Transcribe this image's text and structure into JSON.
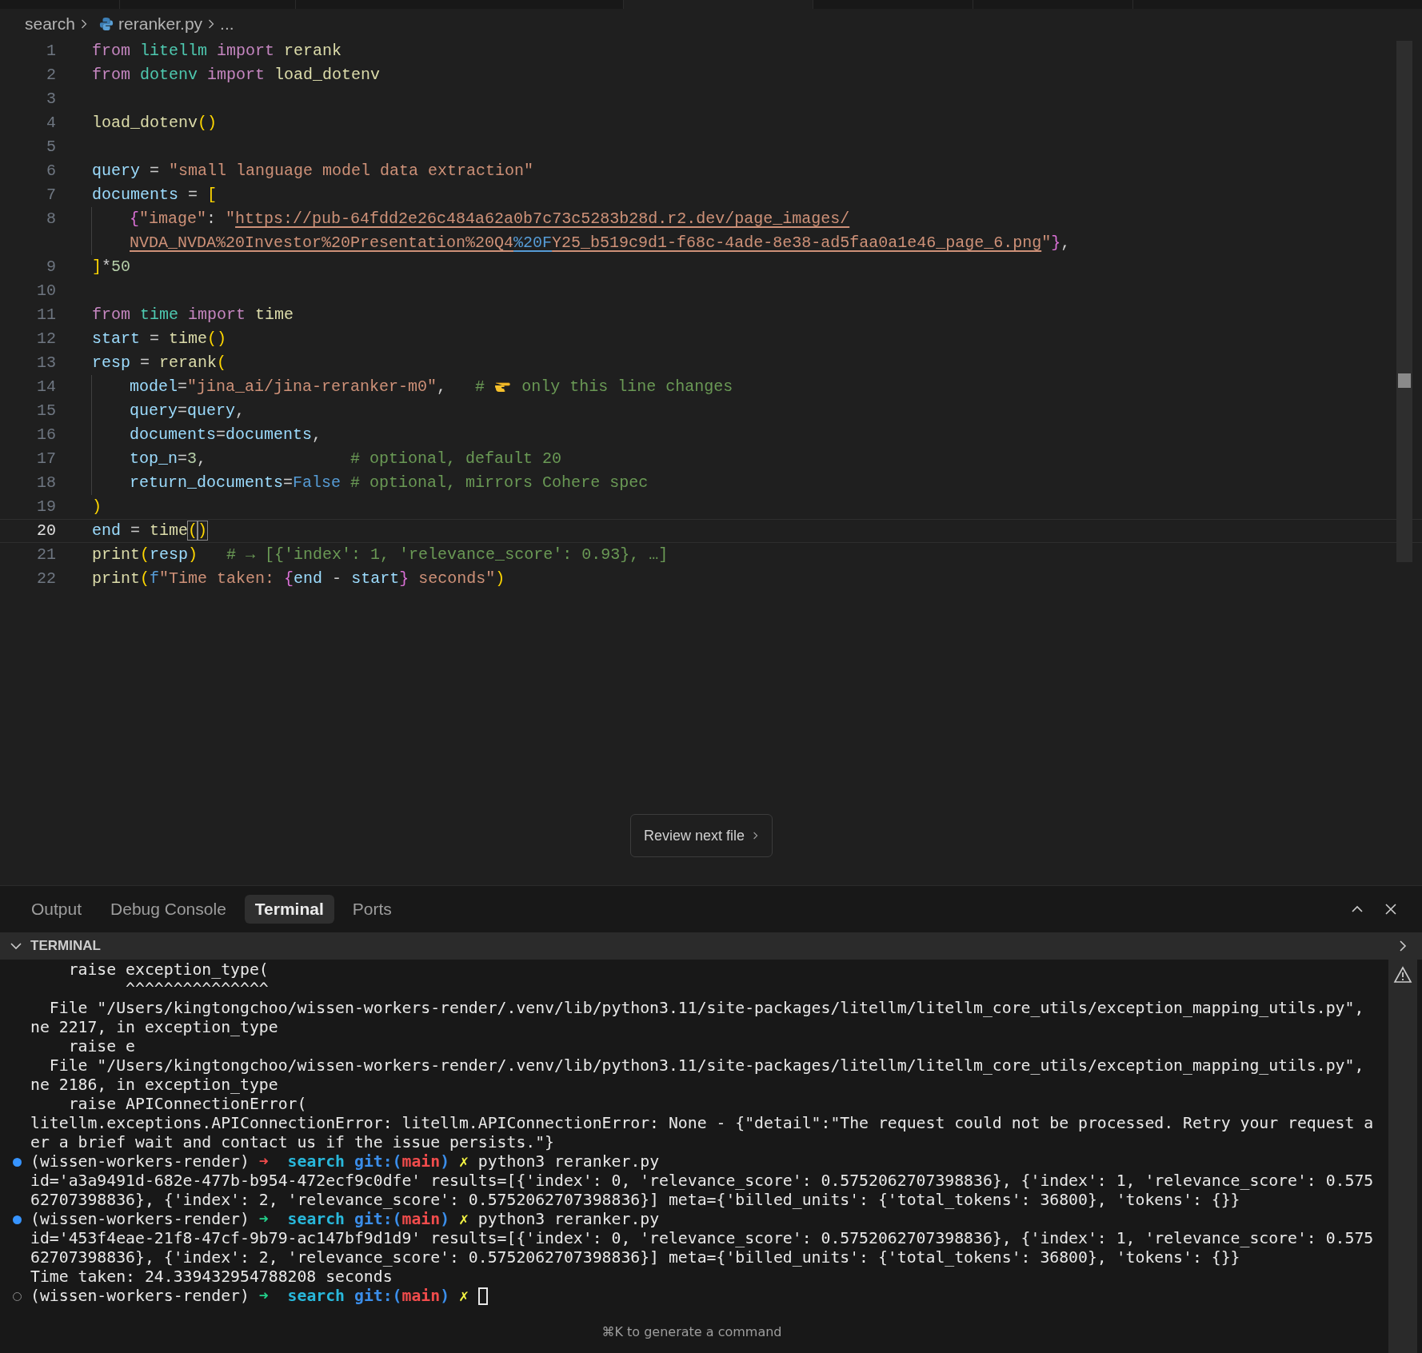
{
  "breadcrumb": {
    "folder": "search",
    "file": "reranker.py",
    "more": "..."
  },
  "editor": {
    "lines": [
      {
        "number": "1",
        "current": false,
        "indented": false,
        "rows": [
          [
            {
              "kind": "keyword",
              "text": "from "
            },
            {
              "kind": "module",
              "text": "litellm "
            },
            {
              "kind": "keyword",
              "text": "import "
            },
            {
              "kind": "function",
              "text": "rerank"
            }
          ]
        ]
      },
      {
        "number": "2",
        "current": false,
        "indented": false,
        "rows": [
          [
            {
              "kind": "keyword",
              "text": "from "
            },
            {
              "kind": "module",
              "text": "dotenv "
            },
            {
              "kind": "keyword",
              "text": "import "
            },
            {
              "kind": "function",
              "text": "load_dotenv"
            }
          ]
        ]
      },
      {
        "number": "3",
        "current": false,
        "indented": false,
        "rows": [
          []
        ]
      },
      {
        "number": "4",
        "current": false,
        "indented": false,
        "rows": [
          [
            {
              "kind": "function",
              "text": "load_dotenv"
            },
            {
              "kind": "bracket",
              "text": "()"
            }
          ]
        ]
      },
      {
        "number": "5",
        "current": false,
        "indented": false,
        "rows": [
          []
        ]
      },
      {
        "number": "6",
        "current": false,
        "indented": false,
        "rows": [
          [
            {
              "kind": "variable",
              "text": "query"
            },
            {
              "kind": "plain",
              "text": " = "
            },
            {
              "kind": "string",
              "text": "\"small language model data extraction\""
            }
          ]
        ]
      },
      {
        "number": "7",
        "current": false,
        "indented": false,
        "rows": [
          [
            {
              "kind": "variable",
              "text": "documents"
            },
            {
              "kind": "plain",
              "text": " = "
            },
            {
              "kind": "bracket",
              "text": "["
            }
          ]
        ]
      },
      {
        "number": "8",
        "current": false,
        "indented": true,
        "rows": [
          [
            {
              "kind": "brace",
              "text": "{"
            },
            {
              "kind": "string",
              "text": "\"image\""
            },
            {
              "kind": "plain",
              "text": ": "
            },
            {
              "kind": "string",
              "text": "\""
            },
            {
              "kind": "link",
              "text": "https://pub-64fdd2e26c484a62a0b7c73c5283b28d.r2.dev/page_images/"
            }
          ]
        ],
        "wrapped": [
          {
            "kind": "link",
            "text": "NVDA_NVDA%20Investor%20Presentation%20Q4"
          },
          {
            "kind": "link_escape",
            "text": "%20F"
          },
          {
            "kind": "link",
            "text": "Y25_b519c9d1-f68c-4ade-8e38-ad5faa0a1e46_page_6.png"
          },
          {
            "kind": "string",
            "text": "\""
          },
          {
            "kind": "brace",
            "text": "}"
          },
          {
            "kind": "plain",
            "text": ","
          }
        ]
      },
      {
        "number": "9",
        "current": false,
        "indented": false,
        "rows": [
          [
            {
              "kind": "bracket",
              "text": "]"
            },
            {
              "kind": "plain",
              "text": "*"
            },
            {
              "kind": "number",
              "text": "50"
            }
          ]
        ]
      },
      {
        "number": "10",
        "current": false,
        "indented": false,
        "rows": [
          []
        ]
      },
      {
        "number": "11",
        "current": false,
        "indented": false,
        "rows": [
          [
            {
              "kind": "keyword",
              "text": "from "
            },
            {
              "kind": "module",
              "text": "time "
            },
            {
              "kind": "keyword",
              "text": "import "
            },
            {
              "kind": "function",
              "text": "time"
            }
          ]
        ]
      },
      {
        "number": "12",
        "current": false,
        "indented": false,
        "rows": [
          [
            {
              "kind": "variable",
              "text": "start"
            },
            {
              "kind": "plain",
              "text": " = "
            },
            {
              "kind": "function",
              "text": "time"
            },
            {
              "kind": "bracket",
              "text": "()"
            }
          ]
        ]
      },
      {
        "number": "13",
        "current": false,
        "indented": false,
        "rows": [
          [
            {
              "kind": "variable",
              "text": "resp"
            },
            {
              "kind": "plain",
              "text": " = "
            },
            {
              "kind": "function",
              "text": "rerank"
            },
            {
              "kind": "bracket",
              "text": "("
            }
          ]
        ]
      },
      {
        "number": "14",
        "current": false,
        "indented": true,
        "rows": [
          [
            {
              "kind": "variable",
              "text": "model"
            },
            {
              "kind": "plain",
              "text": "="
            },
            {
              "kind": "string",
              "text": "\"jina_ai/jina-reranker-m0\""
            },
            {
              "kind": "plain",
              "text": ",   "
            },
            {
              "kind": "comment",
              "text": "# "
            },
            {
              "kind": "pointing_hand"
            },
            {
              "kind": "comment",
              "text": " only this line changes"
            }
          ]
        ]
      },
      {
        "number": "15",
        "current": false,
        "indented": true,
        "rows": [
          [
            {
              "kind": "variable",
              "text": "query"
            },
            {
              "kind": "plain",
              "text": "="
            },
            {
              "kind": "variable",
              "text": "query"
            },
            {
              "kind": "plain",
              "text": ","
            }
          ]
        ]
      },
      {
        "number": "16",
        "current": false,
        "indented": true,
        "rows": [
          [
            {
              "kind": "variable",
              "text": "documents"
            },
            {
              "kind": "plain",
              "text": "="
            },
            {
              "kind": "variable",
              "text": "documents"
            },
            {
              "kind": "plain",
              "text": ","
            }
          ]
        ]
      },
      {
        "number": "17",
        "current": false,
        "indented": true,
        "rows": [
          [
            {
              "kind": "variable",
              "text": "top_n"
            },
            {
              "kind": "plain",
              "text": "="
            },
            {
              "kind": "number",
              "text": "3"
            },
            {
              "kind": "plain",
              "text": ",               "
            },
            {
              "kind": "comment",
              "text": "# optional, default 20"
            }
          ]
        ]
      },
      {
        "number": "18",
        "current": false,
        "indented": true,
        "rows": [
          [
            {
              "kind": "variable",
              "text": "return_documents"
            },
            {
              "kind": "plain",
              "text": "="
            },
            {
              "kind": "constant",
              "text": "False"
            },
            {
              "kind": "plain",
              "text": " "
            },
            {
              "kind": "comment",
              "text": "# optional, mirrors Cohere spec"
            }
          ]
        ]
      },
      {
        "number": "19",
        "current": false,
        "indented": false,
        "rows": [
          [
            {
              "kind": "bracket",
              "text": ")"
            }
          ]
        ]
      },
      {
        "number": "20",
        "current": true,
        "indented": false,
        "rows": [
          [
            {
              "kind": "variable",
              "text": "end"
            },
            {
              "kind": "plain",
              "text": " = "
            },
            {
              "kind": "function",
              "text": "time"
            },
            {
              "kind": "bracket_match",
              "text": "("
            },
            {
              "kind": "bracket_match",
              "text": ")"
            }
          ]
        ]
      },
      {
        "number": "21",
        "current": false,
        "indented": false,
        "rows": [
          [
            {
              "kind": "function",
              "text": "print"
            },
            {
              "kind": "bracket",
              "text": "("
            },
            {
              "kind": "variable",
              "text": "resp"
            },
            {
              "kind": "bracket",
              "text": ")"
            },
            {
              "kind": "comment",
              "text": "   # → [{'index': 1, 'relevance_score': 0.93}, …]"
            }
          ]
        ]
      },
      {
        "number": "22",
        "current": false,
        "indented": false,
        "rows": [
          [
            {
              "kind": "function",
              "text": "print"
            },
            {
              "kind": "bracket",
              "text": "("
            },
            {
              "kind": "constant",
              "text": "f"
            },
            {
              "kind": "string",
              "text": "\"Time taken: "
            },
            {
              "kind": "brace",
              "text": "{"
            },
            {
              "kind": "variable",
              "text": "end"
            },
            {
              "kind": "plain",
              "text": " - "
            },
            {
              "kind": "variable",
              "text": "start"
            },
            {
              "kind": "brace",
              "text": "}"
            },
            {
              "kind": "string",
              "text": " seconds\""
            },
            {
              "kind": "bracket",
              "text": ")"
            }
          ]
        ]
      }
    ],
    "review_button": "Review next file"
  },
  "panel": {
    "tabs": [
      {
        "label": "Output",
        "selected": false
      },
      {
        "label": "Debug Console",
        "selected": false
      },
      {
        "label": "Terminal",
        "selected": true
      },
      {
        "label": "Ports",
        "selected": false
      }
    ],
    "section_title": "TERMINAL",
    "terminal_lines": [
      {
        "kind": "text",
        "text": "    raise exception_type("
      },
      {
        "kind": "text",
        "text": "          ^^^^^^^^^^^^^^^"
      },
      {
        "kind": "text",
        "text": "  File \"/Users/kingtongchoo/wissen-workers-render/.venv/lib/python3.11/site-packages/litellm/litellm_core_utils/exception_mapping_utils.py\","
      },
      {
        "kind": "text",
        "text": "ne 2217, in exception_type"
      },
      {
        "kind": "text",
        "text": "    raise e"
      },
      {
        "kind": "text",
        "text": "  File \"/Users/kingtongchoo/wissen-workers-render/.venv/lib/python3.11/site-packages/litellm/litellm_core_utils/exception_mapping_utils.py\","
      },
      {
        "kind": "text",
        "text": "ne 2186, in exception_type"
      },
      {
        "kind": "text",
        "text": "    raise APIConnectionError("
      },
      {
        "kind": "text",
        "text": "litellm.exceptions.APIConnectionError: litellm.APIConnectionError: None - {\"detail\":\"The request could not be processed. Retry your request a"
      },
      {
        "kind": "text",
        "text": "er a brief wait and contact us if the issue persists.\"}"
      },
      {
        "kind": "prompt",
        "ran": true,
        "last_ok": false,
        "env": "(wissen-workers-render) ",
        "arrow": "➜",
        "dir": "search",
        "git_open": "git:(",
        "branch": "main",
        "git_close": ")",
        "dirty": "✗",
        "command": "python3 reranker.py",
        "cursor": false
      },
      {
        "kind": "text",
        "text": "id='a3a9491d-682e-477b-b954-472ecf9c0dfe' results=[{'index': 0, 'relevance_score': 0.5752062707398836}, {'index': 1, 'relevance_score': 0.575"
      },
      {
        "kind": "text",
        "text": "62707398836}, {'index': 2, 'relevance_score': 0.5752062707398836}] meta={'billed_units': {'total_tokens': 36800}, 'tokens': {}}"
      },
      {
        "kind": "prompt",
        "ran": true,
        "last_ok": true,
        "env": "(wissen-workers-render) ",
        "arrow": "➜",
        "dir": "search",
        "git_open": "git:(",
        "branch": "main",
        "git_close": ")",
        "dirty": "✗",
        "command": "python3 reranker.py",
        "cursor": false
      },
      {
        "kind": "text",
        "text": "id='453f4eae-21f8-47cf-9b79-ac147bf9d1d9' results=[{'index': 0, 'relevance_score': 0.5752062707398836}, {'index': 1, 'relevance_score': 0.575"
      },
      {
        "kind": "text",
        "text": "62707398836}, {'index': 2, 'relevance_score': 0.5752062707398836}] meta={'billed_units': {'total_tokens': 36800}, 'tokens': {}}"
      },
      {
        "kind": "text",
        "text": "Time taken: 24.339432954788208 seconds"
      },
      {
        "kind": "prompt",
        "ran": false,
        "last_ok": true,
        "env": "(wissen-workers-render) ",
        "arrow": "➜",
        "dir": "search",
        "git_open": "git:(",
        "branch": "main",
        "git_close": ")",
        "dirty": "✗",
        "cursor": true
      }
    ],
    "hint": "⌘K to generate a command"
  }
}
